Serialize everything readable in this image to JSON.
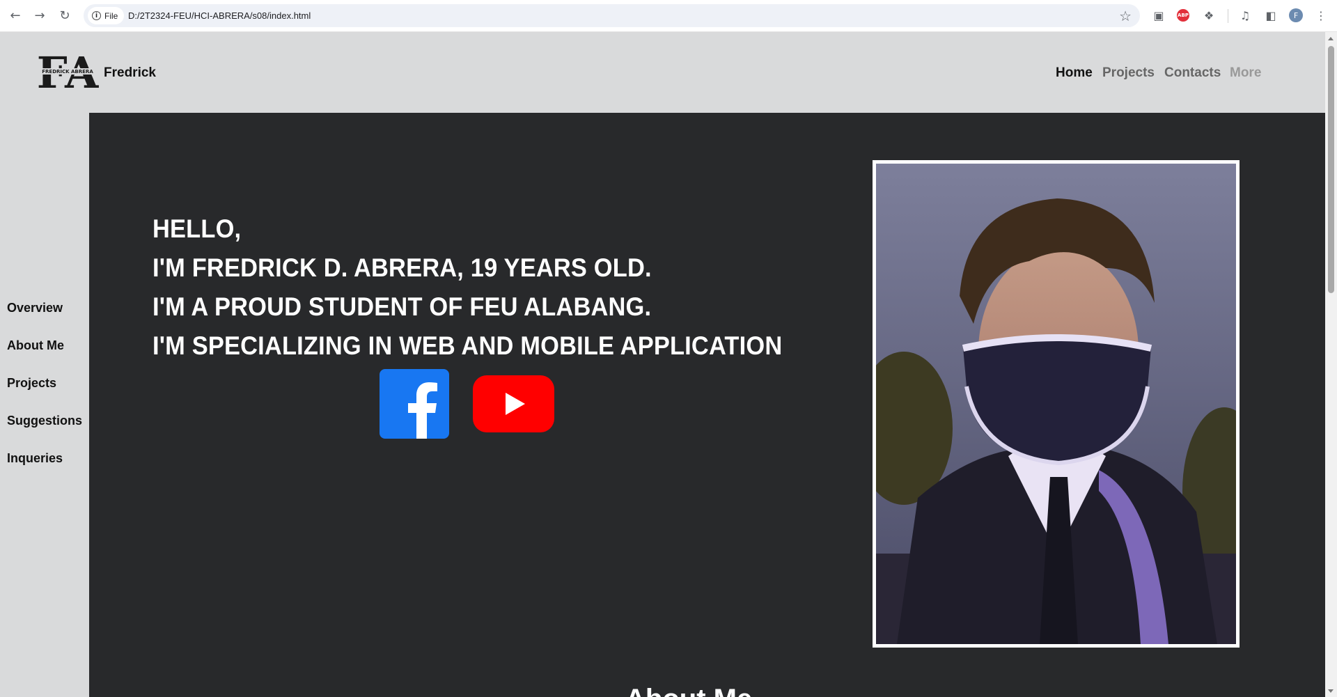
{
  "browser": {
    "file_chip": "File",
    "url": "D:/2T2324-FEU/HCI-ABRERA/s08/index.html",
    "avatar_letter": "F",
    "abp_label": "ABP"
  },
  "header": {
    "logo_text": "FA",
    "logo_subtext": "FREDRICK ABRERA",
    "brand_name": "Fredrick",
    "nav": [
      "Home",
      "Projects",
      "Contacts",
      "More"
    ]
  },
  "sidebar": {
    "items": [
      "Overview",
      "About Me",
      "Projects",
      "Suggestions",
      "Inqueries"
    ]
  },
  "hero": {
    "lines": [
      "HELLO,",
      "I'M FREDRICK D. ABRERA, 19 YEARS OLD.",
      "I'M A PROUD STUDENT OF FEU ALABANG.",
      "I'M SPECIALIZING IN WEB AND MOBILE APPLICATION"
    ],
    "social": [
      "facebook-icon",
      "youtube-icon"
    ],
    "next_heading": "About Me"
  },
  "colors": {
    "page_bg": "#d9dadb",
    "hero_bg": "#28292b",
    "nav_active": "#111111",
    "nav_inactive": "#666666",
    "nav_disabled": "#999999",
    "facebook": "#1877f2",
    "youtube": "#ff0000"
  }
}
